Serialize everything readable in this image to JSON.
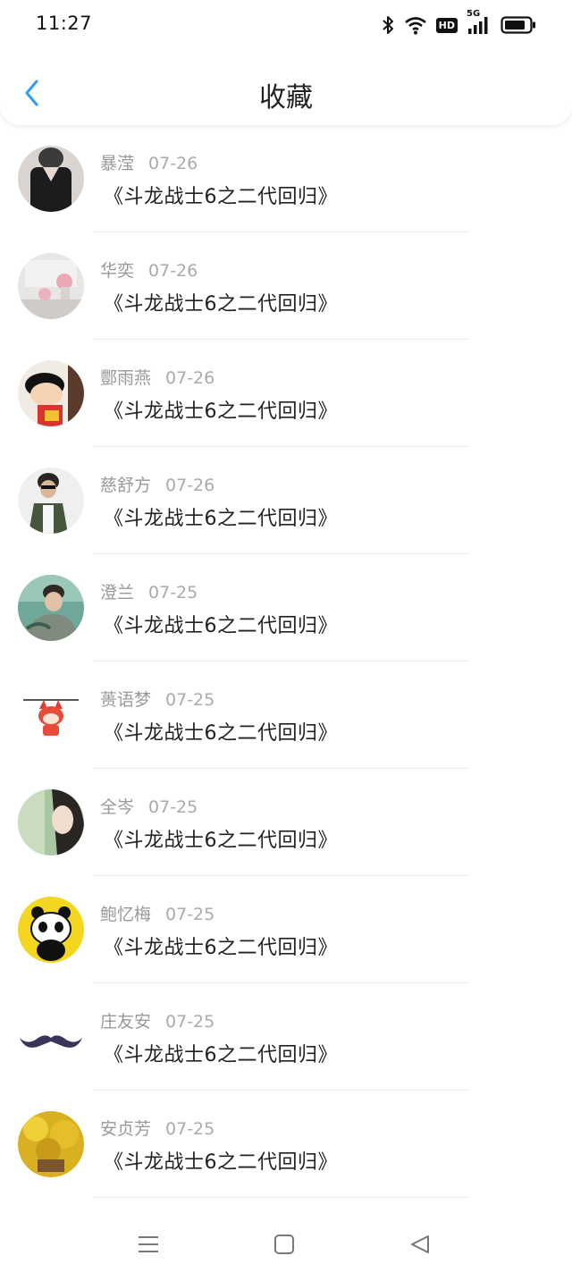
{
  "status_bar": {
    "time": "11:27",
    "hd_badge": "HD",
    "network": "5G",
    "icons": [
      "bluetooth-icon",
      "wifi-icon",
      "hd-badge",
      "5g-signal-icon",
      "battery-icon"
    ]
  },
  "nav": {
    "title": "收藏",
    "back_icon": "chevron-left-icon",
    "accent_color": "#2e9df2"
  },
  "favorites": [
    {
      "name": "暴滢",
      "date": "07-26",
      "content": "《斗龙战士6之二代回归》"
    },
    {
      "name": "华奕",
      "date": "07-26",
      "content": "《斗龙战士6之二代回归》"
    },
    {
      "name": "酆雨燕",
      "date": "07-26",
      "content": "《斗龙战士6之二代回归》"
    },
    {
      "name": "慈舒方",
      "date": "07-26",
      "content": "《斗龙战士6之二代回归》"
    },
    {
      "name": "澄兰",
      "date": "07-25",
      "content": "《斗龙战士6之二代回归》"
    },
    {
      "name": "蒉语梦",
      "date": "07-25",
      "content": "《斗龙战士6之二代回归》"
    },
    {
      "name": "全岑",
      "date": "07-25",
      "content": "《斗龙战士6之二代回归》"
    },
    {
      "name": "鲍忆梅",
      "date": "07-25",
      "content": "《斗龙战士6之二代回归》"
    },
    {
      "name": "庄友安",
      "date": "07-25",
      "content": "《斗龙战士6之二代回归》"
    },
    {
      "name": "安贞芳",
      "date": "07-25",
      "content": "《斗龙战士6之二代回归》"
    }
  ],
  "bottom_nav": {
    "icons": [
      "menu-icon",
      "home-square-icon",
      "back-triangle-icon"
    ]
  }
}
